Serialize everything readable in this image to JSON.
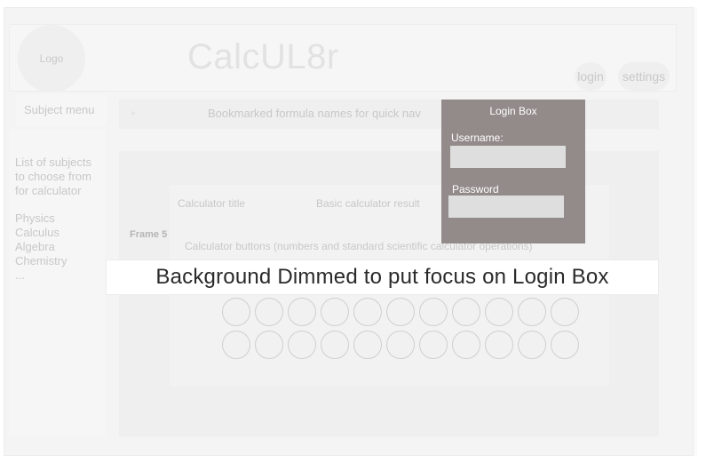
{
  "header": {
    "logo_label": "Logo",
    "app_title": "CalcUL8r",
    "login_label": "login",
    "settings_label": "settings"
  },
  "sidebar": {
    "menu_title": "Subject menu",
    "description": "List of subjects to choose from for calculator",
    "subjects": [
      "Physics",
      "Calculus",
      "Algebra",
      "Chemistry",
      "..."
    ]
  },
  "bookmarks": {
    "text": "Bookmarked formula names for quick nav"
  },
  "calculator": {
    "frame_label": "Frame 5",
    "title": "Calculator title",
    "result": "Basic calculator result",
    "buttons_text": "Calculator buttons (numbers and standard scientific calculator operations)",
    "button_rows": [
      11,
      11
    ]
  },
  "overlay": {
    "text": "Background Dimmed to put focus on Login Box"
  },
  "login_box": {
    "title": "Login Box",
    "username_label": "Username:",
    "username_value": "",
    "password_label": "Password",
    "password_value": ""
  },
  "colors": {
    "login_box_bg": "#938b89",
    "input_bg": "#dedede",
    "dimmed_text": "#c8c8c8"
  }
}
